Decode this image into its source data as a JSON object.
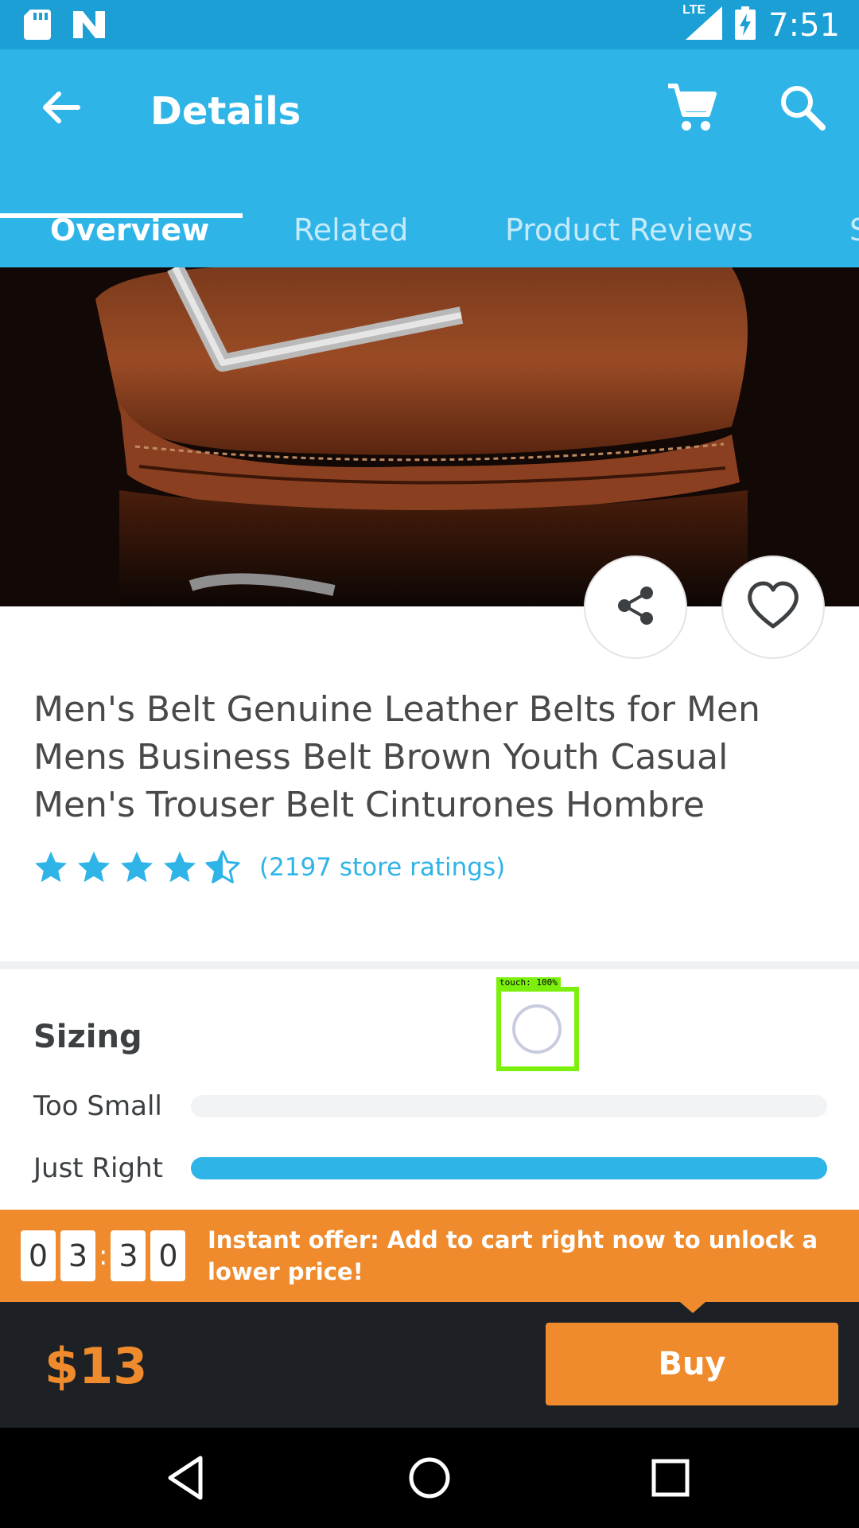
{
  "status_bar": {
    "time": "7:51",
    "network": "LTE",
    "icons": [
      "sd-card-icon",
      "n-notification-icon",
      "signal-icon",
      "battery-charging-icon"
    ]
  },
  "app_bar": {
    "title": "Details",
    "back_icon": "arrow-back-icon",
    "cart_icon": "cart-icon",
    "search_icon": "search-icon"
  },
  "tabs": [
    {
      "label": "Overview",
      "active": true
    },
    {
      "label": "Related",
      "active": false
    },
    {
      "label": "Product Reviews",
      "active": false
    },
    {
      "label": "S",
      "active": false
    }
  ],
  "product": {
    "title": "Men's Belt Genuine Leather Belts for Men Mens Business Belt Brown Youth Casual Men's Trouser Belt Cinturones Hombre",
    "rating_value": 4.5,
    "rating_max": 5,
    "rating_text": "(2197 store ratings)",
    "share_icon": "share-icon",
    "wishlist_icon": "heart-outline-icon"
  },
  "sizing": {
    "title": "Sizing",
    "rows": [
      {
        "label": "Too Small",
        "fraction": 0.0
      },
      {
        "label": "Just Right",
        "fraction": 1.0
      }
    ]
  },
  "touch_overlay": {
    "label": "touch: 100%"
  },
  "offer": {
    "timer_digits": [
      "0",
      "3",
      "3",
      "0"
    ],
    "timer_separator": ":",
    "text": "Instant offer: Add to cart right now to unlock a lower price!"
  },
  "buy_bar": {
    "price": "$13",
    "buy_label": "Buy"
  },
  "nav_bar": {
    "back_icon": "nav-back-icon",
    "home_icon": "nav-home-icon",
    "recents_icon": "nav-recents-icon"
  },
  "colors": {
    "primary": "#2fb4e8",
    "status_bar": "#1c9fd5",
    "accent": "#ef8b2c",
    "buy_bar_bg": "#1d2125",
    "notification_dot": "#ef5f5f"
  }
}
